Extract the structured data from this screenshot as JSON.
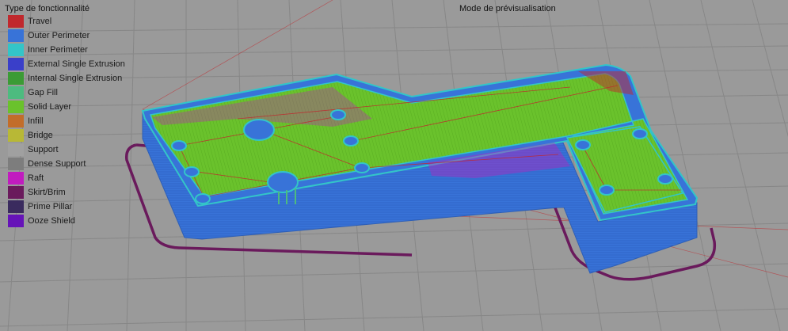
{
  "legend": {
    "title": "Type de fonctionnalité",
    "items": [
      {
        "label": "Travel",
        "color": "#c0282d"
      },
      {
        "label": "Outer Perimeter",
        "color": "#3873d8"
      },
      {
        "label": "Inner Perimeter",
        "color": "#33c5c8"
      },
      {
        "label": "External Single Extrusion",
        "color": "#3a3fc9"
      },
      {
        "label": "Internal Single Extrusion",
        "color": "#3b9b35"
      },
      {
        "label": "Gap Fill",
        "color": "#4dbb7f"
      },
      {
        "label": "Solid Layer",
        "color": "#6ac22c"
      },
      {
        "label": "Infill",
        "color": "#c26d2a"
      },
      {
        "label": "Bridge",
        "color": "#b8b836"
      },
      {
        "label": "Support",
        "color": "#a0a0a0"
      },
      {
        "label": "Dense Support",
        "color": "#7d7d7d"
      },
      {
        "label": "Raft",
        "color": "#c11cbf"
      },
      {
        "label": "Skirt/Brim",
        "color": "#6a1a5c"
      },
      {
        "label": "Prime Pillar",
        "color": "#3a2b5e"
      },
      {
        "label": "Ooze Shield",
        "color": "#6613b8"
      }
    ]
  },
  "view": {
    "mode_title": "Mode de prévisualisation"
  },
  "colors": {
    "background": "#9a9a9a",
    "grid": "#878787",
    "part_top": "#6ac22c",
    "part_side": "#3873d8",
    "skirt": "#6a1a5c",
    "travel": "#c0282d",
    "raft": "#c11cbf"
  }
}
